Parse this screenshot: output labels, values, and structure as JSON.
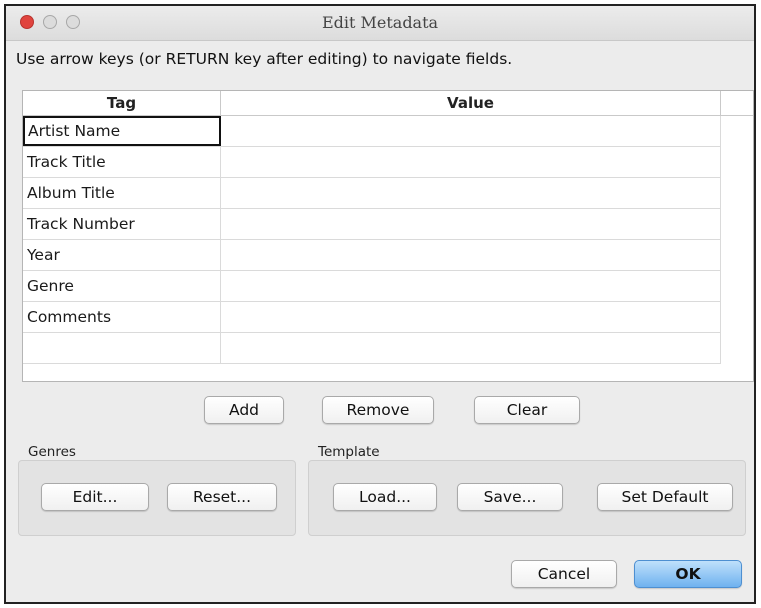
{
  "window": {
    "title": "Edit Metadata"
  },
  "instructions": "Use arrow keys (or RETURN key after editing) to navigate fields.",
  "table": {
    "headers": {
      "tag": "Tag",
      "value": "Value"
    },
    "rows": [
      {
        "tag": "Artist Name",
        "value": ""
      },
      {
        "tag": "Track Title",
        "value": ""
      },
      {
        "tag": "Album Title",
        "value": ""
      },
      {
        "tag": "Track Number",
        "value": ""
      },
      {
        "tag": "Year",
        "value": ""
      },
      {
        "tag": "Genre",
        "value": ""
      },
      {
        "tag": "Comments",
        "value": ""
      },
      {
        "tag": "",
        "value": ""
      }
    ],
    "selected_row": "Artist Name"
  },
  "table_actions": {
    "add": "Add",
    "remove": "Remove",
    "clear": "Clear"
  },
  "genres": {
    "label": "Genres",
    "edit": "Edit...",
    "reset": "Reset..."
  },
  "template": {
    "label": "Template",
    "load": "Load...",
    "save": "Save...",
    "set_default": "Set Default"
  },
  "dialog_actions": {
    "cancel": "Cancel",
    "ok": "OK"
  },
  "colors": {
    "close": "#e0443e",
    "primary_button": "#6fb2ef",
    "dialog_bg": "#ececec"
  }
}
